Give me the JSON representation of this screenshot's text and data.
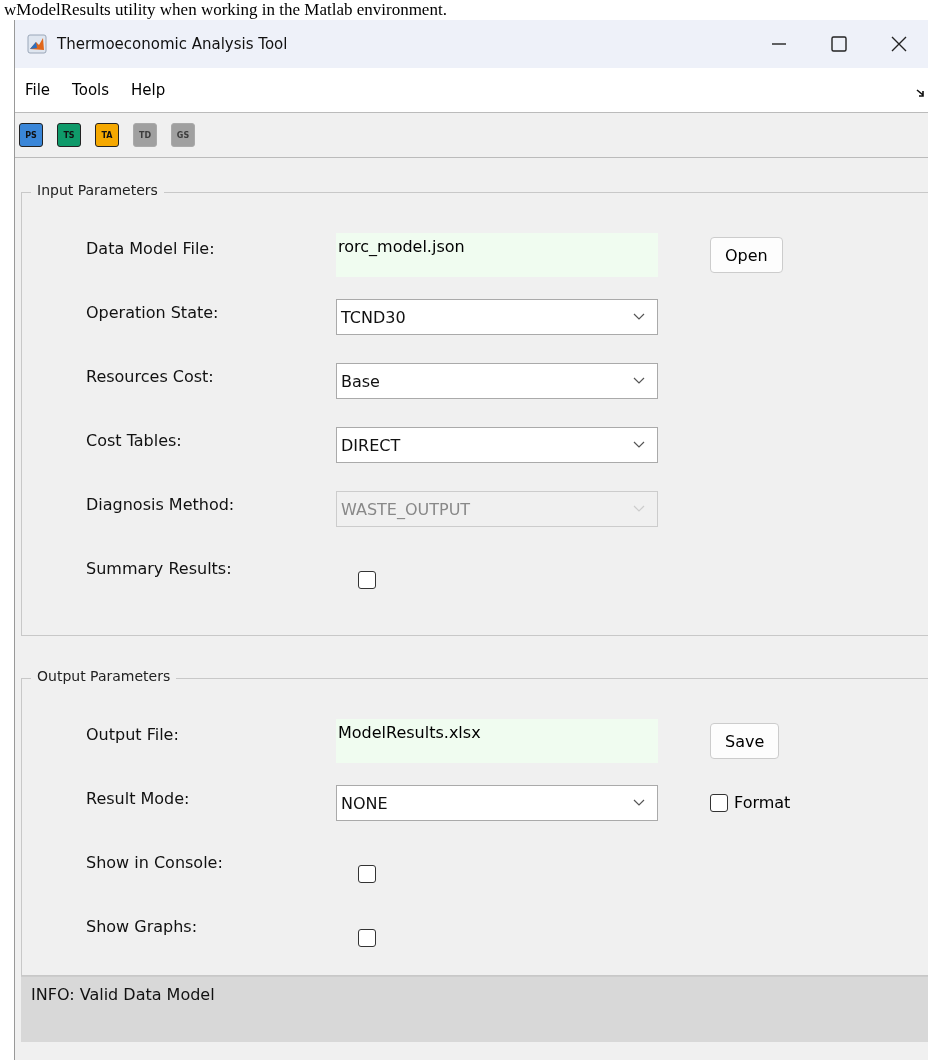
{
  "caption": "wModelResults utility when working in the Matlab environment.",
  "window": {
    "title": "Thermoeconomic Analysis Tool"
  },
  "menu": [
    "File",
    "Tools",
    "Help"
  ],
  "toolbar": [
    {
      "label": "PS",
      "color": "#3a86d8",
      "disabled": false
    },
    {
      "label": "TS",
      "color": "#0f9a6a",
      "disabled": false
    },
    {
      "label": "TA",
      "color": "#f5a800",
      "disabled": false
    },
    {
      "label": "TD",
      "color": "#a0a0a0",
      "disabled": true
    },
    {
      "label": "GS",
      "color": "#a0a0a0",
      "disabled": true
    }
  ],
  "panels": [
    {
      "title": "Input Parameters",
      "rows": [
        {
          "kind": "text",
          "label": "Data Model File:",
          "value": "rorc_model.json",
          "button": "Open"
        },
        {
          "kind": "select",
          "label": "Operation State:",
          "value": "TCND30",
          "disabled": false
        },
        {
          "kind": "select",
          "label": "Resources Cost:",
          "value": "Base",
          "disabled": false
        },
        {
          "kind": "select",
          "label": "Cost Tables:",
          "value": "DIRECT",
          "disabled": false
        },
        {
          "kind": "select",
          "label": "Diagnosis Method:",
          "value": "WASTE_OUTPUT",
          "disabled": true
        },
        {
          "kind": "checkbox",
          "label": "Summary Results:",
          "checked": false
        }
      ]
    },
    {
      "title": "Output Parameters",
      "rows": [
        {
          "kind": "text",
          "label": "Output File:",
          "value": "ModelResults.xlsx",
          "button": "Save"
        },
        {
          "kind": "select",
          "label": "Result Mode:",
          "value": "NONE",
          "disabled": false,
          "extra": {
            "label": "Format",
            "checked": false
          }
        },
        {
          "kind": "checkbox",
          "label": "Show in Console:",
          "checked": false
        },
        {
          "kind": "checkbox",
          "label": "Show Graphs:",
          "checked": false
        }
      ]
    }
  ],
  "status_bar": "INFO: Valid Data Model"
}
